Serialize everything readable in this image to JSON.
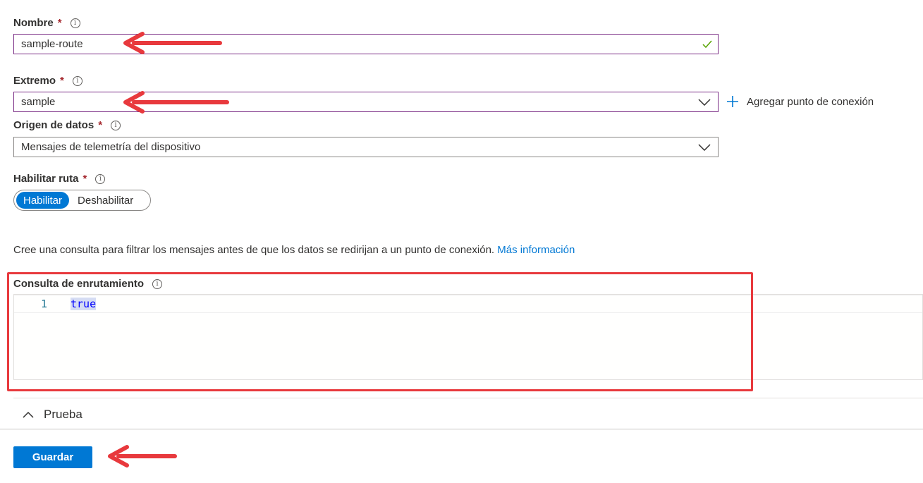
{
  "nombre": {
    "label": "Nombre",
    "required": "*",
    "value": "sample-route"
  },
  "extremo": {
    "label": "Extremo",
    "required": "*",
    "value": "sample",
    "add_label": "Agregar punto de conexión"
  },
  "origen": {
    "label": "Origen de datos",
    "required": "*",
    "value": "Mensajes de telemetría del dispositivo"
  },
  "habilitar": {
    "label": "Habilitar ruta",
    "required": "*",
    "on_label": "Habilitar",
    "off_label": "Deshabilitar",
    "selected": "Habilitar"
  },
  "query_help": {
    "text": "Cree una consulta para filtrar los mensajes antes de que los datos se redirijan a un punto de conexión.",
    "link": "Más información"
  },
  "consulta": {
    "label": "Consulta de enrutamiento",
    "line_number": "1",
    "code": "true"
  },
  "prueba": {
    "label": "Prueba"
  },
  "guardar": {
    "label": "Guardar"
  },
  "colors": {
    "accent": "#0078d4",
    "annotation": "#e8393d",
    "focus_border": "#7b2e86",
    "required": "#a4262c",
    "valid_check": "#57a300"
  },
  "icons": [
    "info-icon",
    "check-icon",
    "chevron-down-icon",
    "plus-icon",
    "chevron-up-icon",
    "arrow-annotation"
  ]
}
